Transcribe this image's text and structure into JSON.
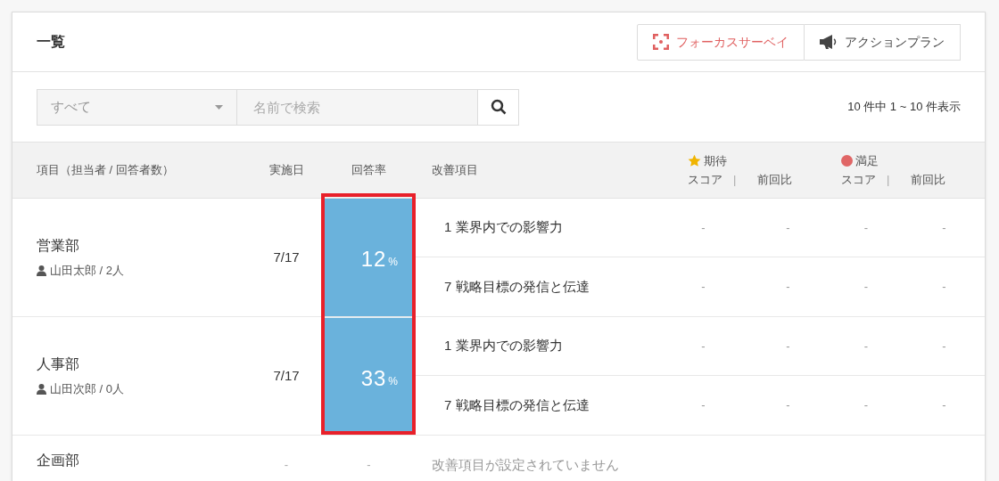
{
  "panel": {
    "title": "一覧",
    "buttons": [
      {
        "kind": "focus",
        "label": "フォーカスサーベイ"
      },
      {
        "kind": "action",
        "label": "アクションプラン"
      }
    ]
  },
  "filter": {
    "select_value": "すべて",
    "search_placeholder": "名前で検索",
    "count": "10 件中 1 ~ 10 件表示"
  },
  "table": {
    "columns": [
      "項目（担当者 / 回答者数）",
      "実施日",
      "回答率",
      "改善項目"
    ],
    "score_groups": [
      {
        "kind": "star",
        "color": "#f0b400",
        "label": "期待",
        "sub": [
          "スコア",
          "|",
          "前回比"
        ]
      },
      {
        "kind": "dot",
        "color": "#e06666",
        "label": "満足",
        "sub": [
          "スコア",
          "|",
          "前回比"
        ]
      }
    ],
    "rows": [
      {
        "name": "営業部",
        "person": "山田太郎 / 2人",
        "date": "7/17",
        "rate": {
          "value": "12",
          "unit": "%"
        },
        "items": [
          {
            "label": "1 業界内での影響力",
            "scores": [
              "-",
              "-",
              "-",
              "-"
            ]
          },
          {
            "label": "7 戦略目標の発信と伝達",
            "scores": [
              "-",
              "-",
              "-",
              "-"
            ]
          }
        ]
      },
      {
        "name": "人事部",
        "person": "山田次郎 / 0人",
        "date": "7/17",
        "rate": {
          "value": "33",
          "unit": "%"
        },
        "items": [
          {
            "label": "1 業界内での影響力",
            "scores": [
              "-",
              "-",
              "-",
              "-"
            ]
          },
          {
            "label": "7 戦略目標の発信と伝達",
            "scores": [
              "-",
              "-",
              "-",
              "-"
            ]
          }
        ]
      },
      {
        "name": "企画部",
        "date": "-",
        "rate_text": "-",
        "empty_note": "改善項目が設定されていません"
      }
    ]
  },
  "highlight_rate_column": true
}
